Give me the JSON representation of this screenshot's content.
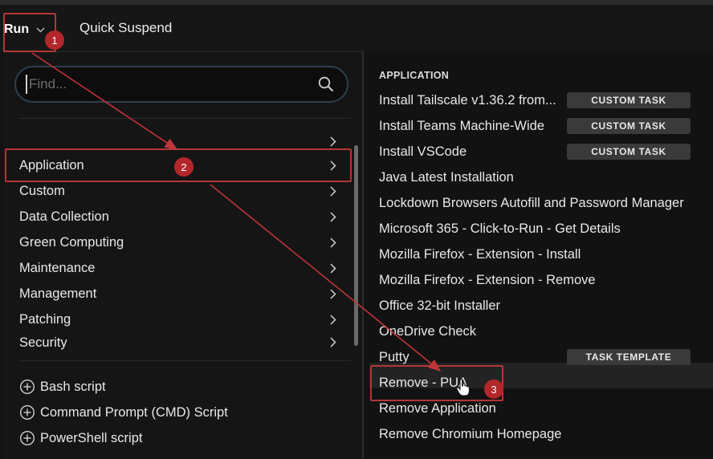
{
  "toolbar": {
    "run_label": "Run",
    "quick_suspend_label": "Quick Suspend"
  },
  "search": {
    "placeholder": "Find..."
  },
  "categories": [
    {
      "label": ""
    },
    {
      "label": "Application"
    },
    {
      "label": "Custom"
    },
    {
      "label": "Data Collection"
    },
    {
      "label": "Green Computing"
    },
    {
      "label": "Maintenance"
    },
    {
      "label": "Management"
    },
    {
      "label": "Patching"
    },
    {
      "label": "Security"
    }
  ],
  "scripts": [
    {
      "label": "Bash script",
      "icon": "plus-circle-icon"
    },
    {
      "label": "Command Prompt (CMD) Script",
      "icon": "plus-circle-icon"
    },
    {
      "label": "PowerShell script",
      "icon": "plus-circle-icon"
    }
  ],
  "right": {
    "section_title": "APPLICATION",
    "tasks": [
      {
        "label": "Install Tailscale v1.36.2 from...",
        "badge": "CUSTOM TASK"
      },
      {
        "label": "Install Teams Machine-Wide",
        "badge": "CUSTOM TASK"
      },
      {
        "label": "Install VSCode",
        "badge": "CUSTOM TASK"
      },
      {
        "label": "Java Latest Installation",
        "badge": ""
      },
      {
        "label": "Lockdown Browsers Autofill and Password Manager",
        "badge": ""
      },
      {
        "label": "Microsoft 365 - Click-to-Run - Get Details",
        "badge": ""
      },
      {
        "label": "Mozilla Firefox - Extension - Install",
        "badge": ""
      },
      {
        "label": "Mozilla Firefox - Extension - Remove",
        "badge": ""
      },
      {
        "label": "Office 32-bit Installer",
        "badge": ""
      },
      {
        "label": "OneDrive Check",
        "badge": ""
      },
      {
        "label": "Putty",
        "badge": "TASK TEMPLATE"
      },
      {
        "label": "Remove - PUA",
        "badge": ""
      },
      {
        "label": "Remove Application",
        "badge": ""
      },
      {
        "label": "Remove Chromium Homepage",
        "badge": ""
      }
    ]
  },
  "annotations": {
    "steps": [
      "1",
      "2",
      "3"
    ],
    "color": "#b3272b"
  },
  "colors": {
    "background": "#131313",
    "badge_bg": "#3a3a3a",
    "highlight": "#b33636"
  }
}
